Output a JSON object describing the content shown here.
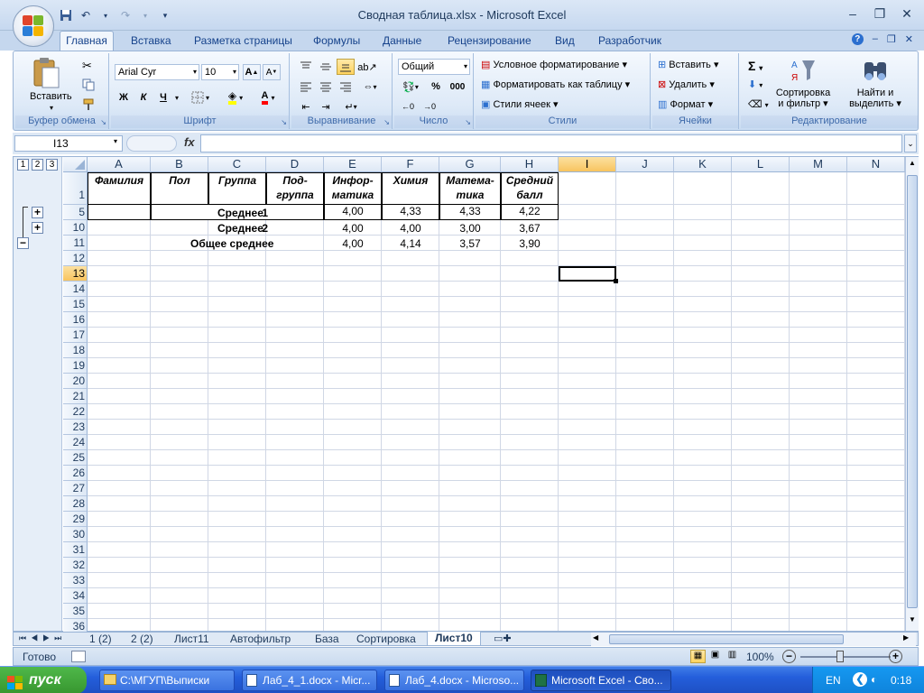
{
  "window": {
    "title": "Сводная таблица.xlsx - Microsoft Excel",
    "controls": [
      "–",
      "❐",
      "✕"
    ]
  },
  "ribbon": {
    "tabs": [
      "Главная",
      "Вставка",
      "Разметка страницы",
      "Формулы",
      "Данные",
      "Рецензирование",
      "Вид",
      "Разработчик"
    ],
    "groups": {
      "clipboard": {
        "label": "Буфер обмена",
        "paste": "Вставить"
      },
      "font": {
        "label": "Шрифт",
        "font_name": "Arial Cyr",
        "font_size": "10",
        "bold": "Ж",
        "italic": "К",
        "underline": "Ч"
      },
      "alignment": {
        "label": "Выравнивание"
      },
      "number": {
        "label": "Число",
        "format": "Общий",
        "percent": "%",
        "thousands": "000"
      },
      "styles": {
        "label": "Стили",
        "conditional": "Условное форматирование",
        "as_table": "Форматировать как таблицу",
        "cell_styles": "Стили ячеек"
      },
      "cells": {
        "label": "Ячейки",
        "insert": "Вставить",
        "delete": "Удалить",
        "format": "Формат"
      },
      "editing": {
        "label": "Редактирование",
        "sort": "Сортировка",
        "sort2": "и фильтр",
        "find": "Найти и",
        "find2": "выделить"
      }
    }
  },
  "formula_bar": {
    "name_box": "I13",
    "fx": "fx",
    "value": ""
  },
  "sheet": {
    "outline_levels": [
      "1",
      "2",
      "3"
    ],
    "columns": [
      "A",
      "B",
      "C",
      "D",
      "E",
      "F",
      "G",
      "H",
      "I",
      "J",
      "K",
      "L",
      "M",
      "N"
    ],
    "selected_column": "I",
    "selected_row": "13",
    "rows": [
      "1",
      "5",
      "10",
      "11",
      "12",
      "13",
      "14",
      "15",
      "16",
      "17",
      "18",
      "19",
      "20",
      "21",
      "22",
      "23",
      "24",
      "25",
      "26",
      "27",
      "28",
      "29",
      "30",
      "31",
      "32",
      "33",
      "34",
      "35",
      "36"
    ],
    "headers": {
      "a": "Фамилия",
      "b": "Пол",
      "c": "Группа",
      "d1": "Под-",
      "d2": "группа",
      "e1": "Инфор-",
      "e2": "матика",
      "f": "Химия",
      "g1": "Матема-",
      "g2": "тика",
      "h1": "Средний",
      "h2": "балл"
    },
    "data_rows": [
      {
        "label_num": "1",
        "label": "Среднее",
        "e": "4,00",
        "f": "4,33",
        "g": "4,33",
        "h": "4,22"
      },
      {
        "label_num": "2",
        "label": "Среднее",
        "e": "4,00",
        "f": "4,00",
        "g": "3,00",
        "h": "3,67"
      },
      {
        "label_num": "",
        "label": "Общее среднее",
        "e": "4,00",
        "f": "4,14",
        "g": "3,57",
        "h": "3,90"
      }
    ]
  },
  "sheet_tabs": [
    "1 (2)",
    "2 (2)",
    "Лист11",
    "Автофильтр",
    "База",
    "Сортировка",
    "Лист10"
  ],
  "active_sheet": "Лист10",
  "status": {
    "ready": "Готово",
    "zoom": "100%"
  },
  "taskbar": {
    "start": "пуск",
    "tasks": [
      "C:\\МГУП\\Выписки",
      "Лаб_4_1.docx - Micr...",
      "Лаб_4.docx - Microso...",
      "Microsoft Excel - Сво..."
    ],
    "lang": "EN",
    "time": "0:18"
  }
}
